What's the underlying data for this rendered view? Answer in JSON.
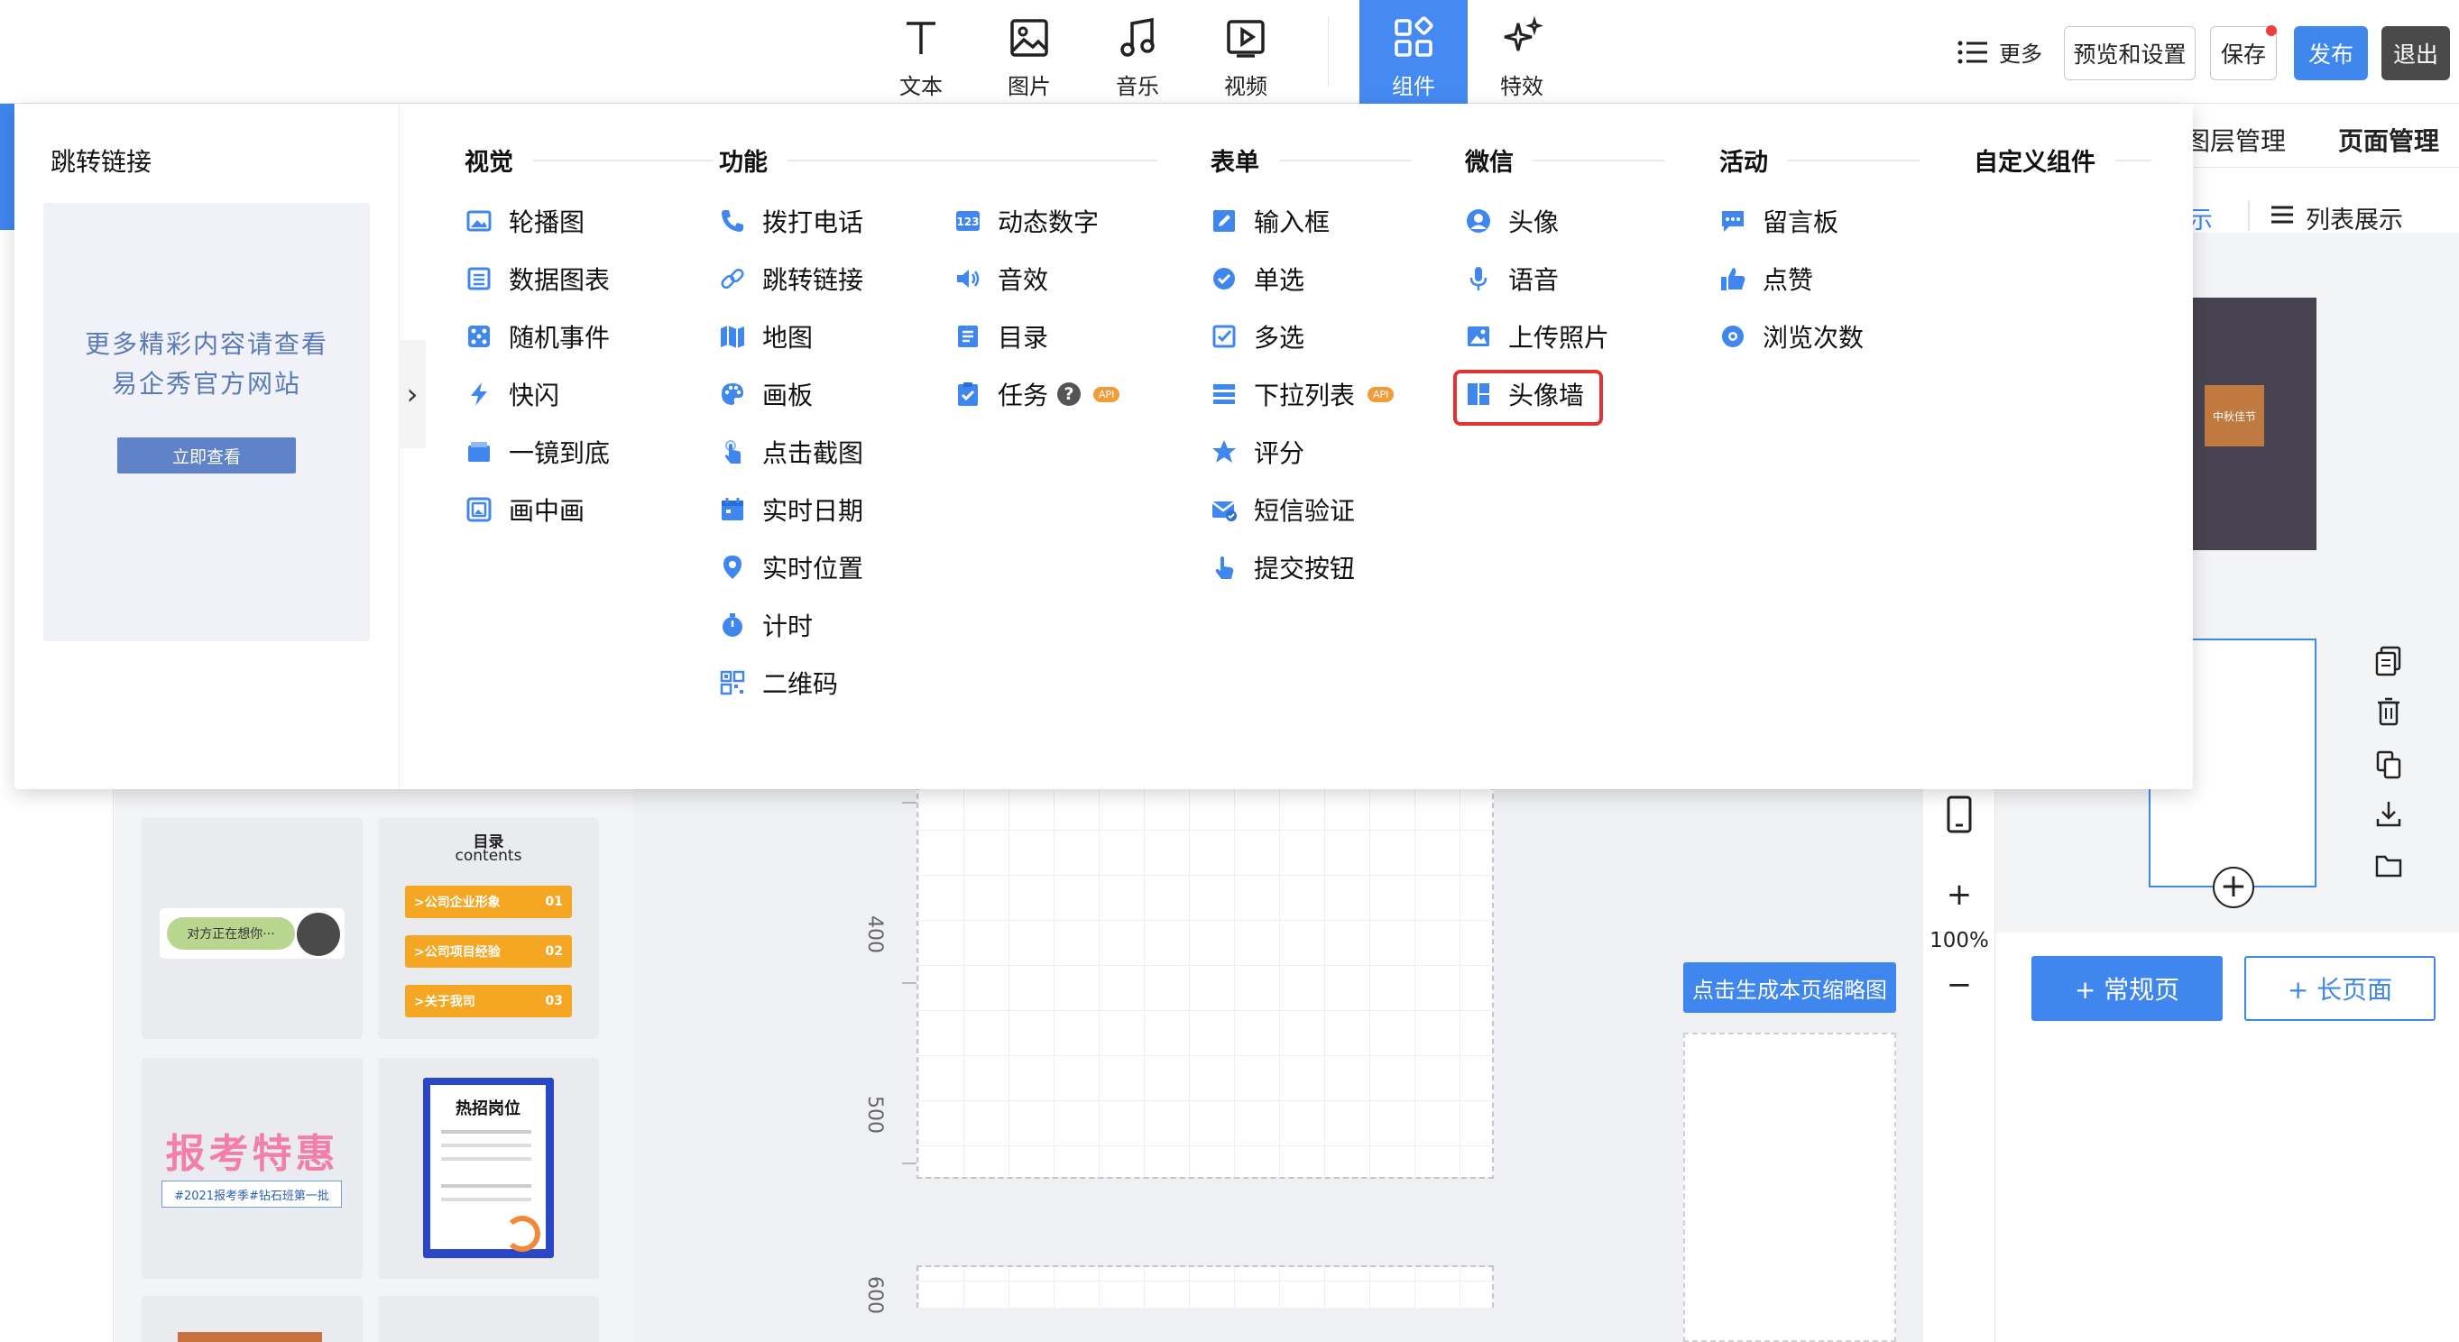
{
  "toolbar": {
    "tools": [
      "文本",
      "图片",
      "音乐",
      "视频",
      "组件",
      "特效"
    ],
    "more": "更多",
    "preview": "预览和设置",
    "save": "保存",
    "publish": "发布",
    "exit": "退出"
  },
  "sidebar": {
    "title": "跳转链接",
    "ad_line1": "更多精彩内容请查看",
    "ad_line2": "易企秀官方网站",
    "ad_button": "立即查看",
    "collapse": "›"
  },
  "categories": {
    "visual": {
      "title": "视觉",
      "items": [
        "轮播图",
        "数据图表",
        "随机事件",
        "快闪",
        "一镜到底",
        "画中画"
      ]
    },
    "function": {
      "title": "功能",
      "items": [
        "拨打电话",
        "跳转链接",
        "地图",
        "画板",
        "点击截图",
        "实时日期",
        "实时位置",
        "计时",
        "二维码"
      ],
      "items2": [
        "动态数字",
        "音效",
        "目录",
        "任务"
      ],
      "badge_api": "API",
      "help": "?"
    },
    "form": {
      "title": "表单",
      "items": [
        "输入框",
        "单选",
        "多选",
        "下拉列表",
        "评分",
        "短信验证",
        "提交按钮"
      ],
      "badge_api": "API"
    },
    "wechat": {
      "title": "微信",
      "items": [
        "头像",
        "语音",
        "上传照片",
        "头像墙"
      ]
    },
    "activity": {
      "title": "活动",
      "items": [
        "留言板",
        "点赞",
        "浏览次数"
      ]
    },
    "custom": {
      "title": "自定义组件"
    }
  },
  "right_panel": {
    "tab_layers": "图层管理",
    "tab_pages": "页面管理",
    "view_grid": "示",
    "view_list": "列表展示",
    "thumb_text": "中秋佳节",
    "add_normal": "+ 常规页",
    "add_long": "+ 长页面"
  },
  "canvas": {
    "zoom": "100%",
    "ruler": [
      "400",
      "500",
      "600"
    ],
    "generate_thumb": "点击生成本页缩略图"
  },
  "templates": {
    "chat_text": "对方正在想你···",
    "toc_title": "目录",
    "toc_sub": "contents",
    "toc_items": [
      ">公司企业形象",
      ">公司项目经验",
      ">关于我司"
    ],
    "toc_nums": [
      "01",
      "02",
      "03"
    ],
    "promo_big": "报考特惠",
    "promo_tag": "#2021报考季#钻石班第一批",
    "hiring_title": "热招岗位"
  },
  "colors": {
    "accent": "#3f86ef",
    "highlight": "#e33434",
    "api_badge": "#f09c3a"
  }
}
